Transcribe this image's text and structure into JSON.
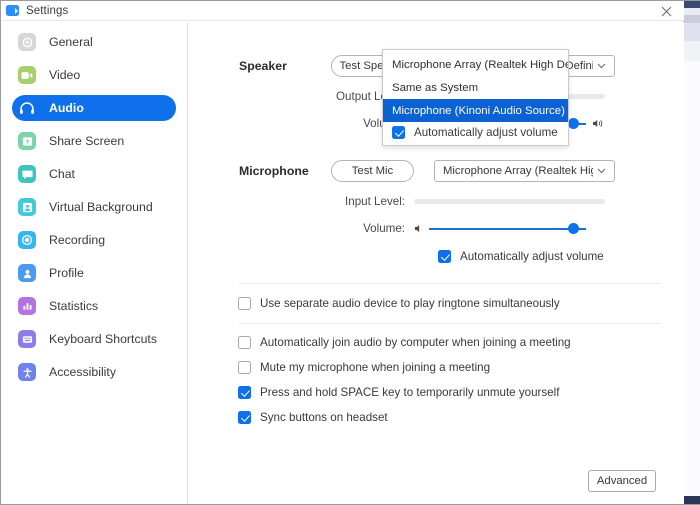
{
  "window": {
    "title": "Settings",
    "logo_icon": "zoom-camera-icon",
    "close_icon": "close-icon"
  },
  "sidebar": {
    "items": [
      {
        "label": "General",
        "icon": "gear-icon",
        "color": "#d7d7db",
        "active": false
      },
      {
        "label": "Video",
        "icon": "video-camera-icon",
        "color": "#a8cf6b",
        "active": false
      },
      {
        "label": "Audio",
        "icon": "headphones-icon",
        "color": "#0e71eb",
        "active": true
      },
      {
        "label": "Share Screen",
        "icon": "share-screen-icon",
        "color": "#7fd3a8",
        "active": false
      },
      {
        "label": "Chat",
        "icon": "chat-bubble-icon",
        "color": "#3fc5bd",
        "active": false
      },
      {
        "label": "Virtual Background",
        "icon": "person-frame-icon",
        "color": "#45c8d8",
        "active": false
      },
      {
        "label": "Recording",
        "icon": "record-circle-icon",
        "color": "#36b6ef",
        "active": false
      },
      {
        "label": "Profile",
        "icon": "person-icon",
        "color": "#4a9bf0",
        "active": false
      },
      {
        "label": "Statistics",
        "icon": "bar-chart-icon",
        "color": "#b473e0",
        "active": false
      },
      {
        "label": "Keyboard Shortcuts",
        "icon": "keyboard-icon",
        "color": "#8d7bea",
        "active": false
      },
      {
        "label": "Accessibility",
        "icon": "accessibility-icon",
        "color": "#6f82ef",
        "active": false
      }
    ]
  },
  "speaker": {
    "section_label": "Speaker",
    "test_button": "Test Speaker",
    "device": "Speakers (Realtek High Definition...",
    "output_level_label": "Output Level:",
    "output_level_percent": 0,
    "volume_label": "Volume:",
    "volume_percent": 92,
    "low_volume_icon": "speaker-low-icon",
    "high_volume_icon": "speaker-high-icon",
    "chevron_icon": "chevron-down-icon"
  },
  "microphone": {
    "section_label": "Microphone",
    "test_button": "Test Mic",
    "device": "Microphone Array (Realtek High ...",
    "input_level_label": "Input Level:",
    "input_level_percent": 0,
    "volume_label": "Volume:",
    "volume_percent": 92,
    "chevron_icon": "chevron-down-icon",
    "dropdown": {
      "open": true,
      "options": [
        {
          "label": "Microphone Array (Realtek High Defini...",
          "selected": false
        },
        {
          "label": "Same as System",
          "selected": false
        },
        {
          "label": "Microphone (Kinoni Audio Source)",
          "selected": true
        }
      ],
      "auto_adjust": {
        "label": "Automatically adjust volume",
        "checked": true
      }
    }
  },
  "options": {
    "ringtone": {
      "label": "Use separate audio device to play ringtone simultaneously",
      "checked": false
    },
    "list": [
      {
        "label": "Automatically join audio by computer when joining a meeting",
        "checked": false
      },
      {
        "label": "Mute my microphone when joining a meeting",
        "checked": false
      },
      {
        "label": "Press and hold SPACE key to temporarily unmute yourself",
        "checked": true
      },
      {
        "label": "Sync buttons on headset",
        "checked": true
      }
    ]
  },
  "footer": {
    "advanced_button": "Advanced"
  },
  "colors": {
    "accent": "#0e71eb",
    "selection": "#0c62d3",
    "text": "#3a3a3c"
  }
}
